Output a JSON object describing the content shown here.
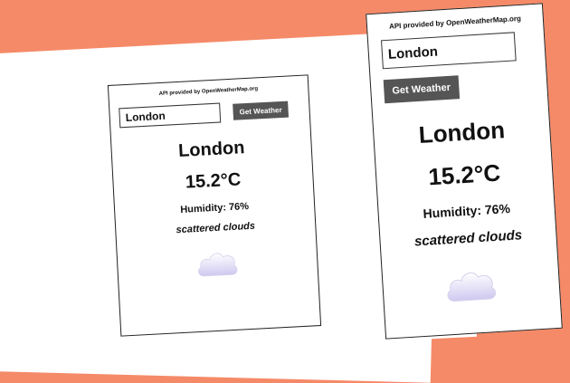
{
  "api_credit": "API provided by OpenWeatherMap.org",
  "search": {
    "value": "London"
  },
  "button_label": "Get Weather",
  "weather": {
    "city": "London",
    "temperature": "15.2°C",
    "humidity": "Humidity: 76%",
    "description": "scattered clouds",
    "icon": "scattered-clouds-icon"
  },
  "colors": {
    "background": "#f58a68",
    "button": "#555555",
    "cloud": "#dcd8f5"
  }
}
